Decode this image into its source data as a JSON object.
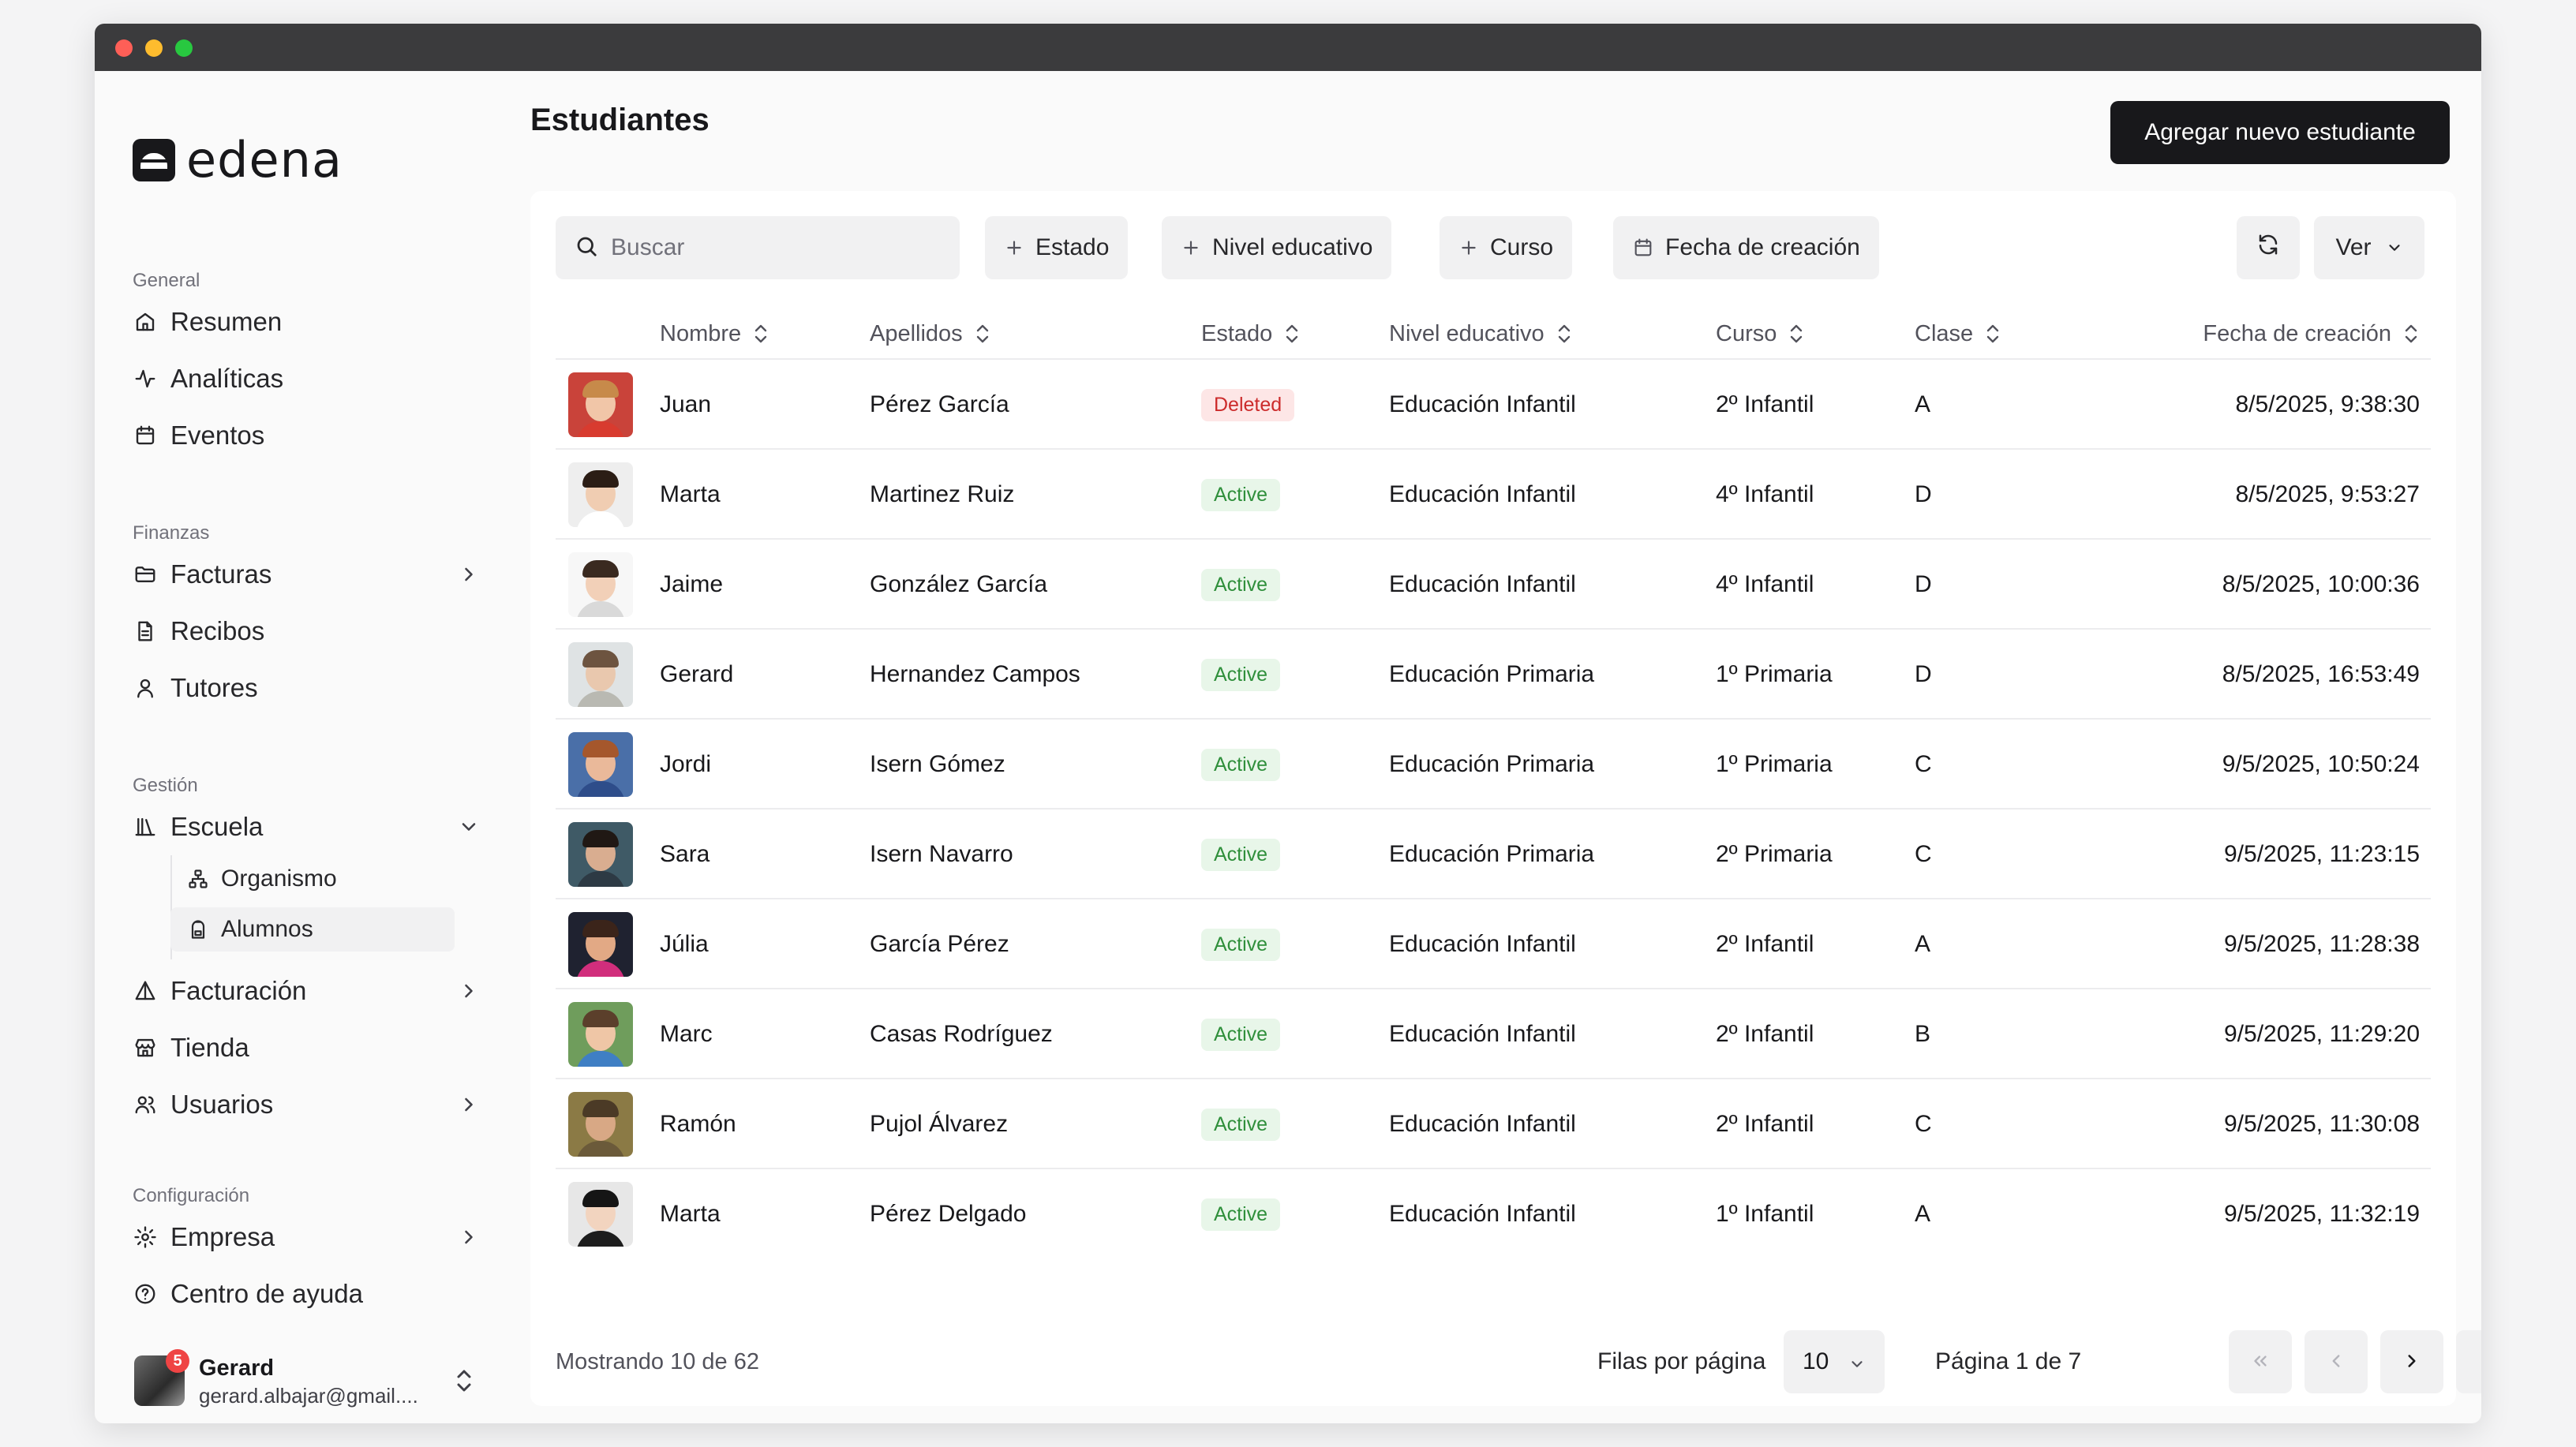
{
  "app": {
    "name": "edena"
  },
  "sidebar": {
    "sections": [
      {
        "label": "General",
        "items": [
          {
            "label": "Resumen",
            "icon": "home-icon"
          },
          {
            "label": "Analíticas",
            "icon": "activity-icon"
          },
          {
            "label": "Eventos",
            "icon": "calendar-icon"
          }
        ]
      },
      {
        "label": "Finanzas",
        "items": [
          {
            "label": "Facturas",
            "icon": "folder-icon",
            "has_children": true
          },
          {
            "label": "Recibos",
            "icon": "file-icon"
          },
          {
            "label": "Tutores",
            "icon": "user-icon"
          }
        ]
      },
      {
        "label": "Gestión",
        "items": [
          {
            "label": "Escuela",
            "icon": "library-icon",
            "expanded": true,
            "children": [
              {
                "label": "Organismo",
                "icon": "network-icon"
              },
              {
                "label": "Alumnos",
                "icon": "backpack-icon",
                "active": true
              }
            ]
          },
          {
            "label": "Facturación",
            "icon": "cone-icon",
            "has_children": true
          },
          {
            "label": "Tienda",
            "icon": "store-icon"
          },
          {
            "label": "Usuarios",
            "icon": "users-icon",
            "has_children": true
          }
        ]
      },
      {
        "label": "Configuración",
        "items": [
          {
            "label": "Empresa",
            "icon": "gear-icon",
            "has_children": true
          },
          {
            "label": "Centro de ayuda",
            "icon": "help-icon"
          }
        ]
      }
    ],
    "user": {
      "name": "Gerard",
      "email": "gerard.albajar@gmail....",
      "notifications": "5"
    }
  },
  "header": {
    "title": "Estudiantes",
    "add_button": "Agregar nuevo estudiante"
  },
  "toolbar": {
    "search_placeholder": "Buscar",
    "filters": [
      "Estado",
      "Nivel educativo",
      "Curso"
    ],
    "date_filter": "Fecha de creación",
    "view_label": "Ver"
  },
  "table": {
    "columns": [
      "Nombre",
      "Apellidos",
      "Estado",
      "Nivel educativo",
      "Curso",
      "Clase",
      "Fecha de creación"
    ],
    "rows": [
      {
        "nombre": "Juan",
        "apellidos": "Pérez García",
        "estado": "Deleted",
        "nivel": "Educación Infantil",
        "curso": "2º Infantil",
        "clase": "A",
        "fecha": "8/5/2025, 9:38:30",
        "avatar": {
          "bg": "#c9433a",
          "hair": "#c78a4a",
          "skin": "#f1c6a8",
          "shirt": "#d83b2f"
        }
      },
      {
        "nombre": "Marta",
        "apellidos": "Martinez Ruiz",
        "estado": "Active",
        "nivel": "Educación Infantil",
        "curso": "4º Infantil",
        "clase": "D",
        "fecha": "8/5/2025, 9:53:27",
        "avatar": {
          "bg": "#eeeeee",
          "hair": "#2b1d15",
          "skin": "#f0cdb2",
          "shirt": "#ffffff"
        }
      },
      {
        "nombre": "Jaime",
        "apellidos": "González García",
        "estado": "Active",
        "nivel": "Educación Infantil",
        "curso": "4º Infantil",
        "clase": "D",
        "fecha": "8/5/2025, 10:00:36",
        "avatar": {
          "bg": "#f7f7f7",
          "hair": "#3a2a20",
          "skin": "#f2d0b8",
          "shirt": "#d9d9d9"
        }
      },
      {
        "nombre": "Gerard",
        "apellidos": "Hernandez Campos",
        "estado": "Active",
        "nivel": "Educación Primaria",
        "curso": "1º Primaria",
        "clase": "D",
        "fecha": "8/5/2025, 16:53:49",
        "avatar": {
          "bg": "#dfe3e4",
          "hair": "#6d5440",
          "skin": "#e9c8ae",
          "shirt": "#b9b9b2"
        }
      },
      {
        "nombre": "Jordi",
        "apellidos": "Isern Gómez",
        "estado": "Active",
        "nivel": "Educación Primaria",
        "curso": "1º Primaria",
        "clase": "C",
        "fecha": "9/5/2025, 10:50:24",
        "avatar": {
          "bg": "#4a6fa8",
          "hair": "#a5572c",
          "skin": "#eab99a",
          "shirt": "#2e4d8a"
        }
      },
      {
        "nombre": "Sara",
        "apellidos": "Isern Navarro",
        "estado": "Active",
        "nivel": "Educación Primaria",
        "curso": "2º Primaria",
        "clase": "C",
        "fecha": "9/5/2025, 11:23:15",
        "avatar": {
          "bg": "#3f5a66",
          "hair": "#201814",
          "skin": "#d9ad90",
          "shirt": "#2d3a44"
        }
      },
      {
        "nombre": "Júlia",
        "apellidos": "García Pérez",
        "estado": "Active",
        "nivel": "Educación Infantil",
        "curso": "2º Infantil",
        "clase": "A",
        "fecha": "9/5/2025, 11:28:38",
        "avatar": {
          "bg": "#1f2230",
          "hair": "#3b241a",
          "skin": "#e2a985",
          "shirt": "#d12e7c"
        }
      },
      {
        "nombre": "Marc",
        "apellidos": "Casas Rodríguez",
        "estado": "Active",
        "nivel": "Educación Infantil",
        "curso": "2º Infantil",
        "clase": "B",
        "fecha": "9/5/2025, 11:29:20",
        "avatar": {
          "bg": "#6f9d5c",
          "hair": "#5b3f2b",
          "skin": "#efc6a6",
          "shirt": "#3f7fc4"
        }
      },
      {
        "nombre": "Ramón",
        "apellidos": "Pujol Álvarez",
        "estado": "Active",
        "nivel": "Educación Infantil",
        "curso": "2º Infantil",
        "clase": "C",
        "fecha": "9/5/2025, 11:30:08",
        "avatar": {
          "bg": "#8b7a45",
          "hair": "#4b3a26",
          "skin": "#d8a885",
          "shirt": "#6b5a3a"
        }
      },
      {
        "nombre": "Marta",
        "apellidos": "Pérez Delgado",
        "estado": "Active",
        "nivel": "Educación Infantil",
        "curso": "1º Infantil",
        "clase": "A",
        "fecha": "9/5/2025, 11:32:19",
        "avatar": {
          "bg": "#e7e7e7",
          "hair": "#151515",
          "skin": "#f2d4bf",
          "shirt": "#1d1d1d"
        }
      }
    ]
  },
  "pagination": {
    "showing": "Mostrando 10 de 62",
    "rows_per_page_label": "Filas por página",
    "rows_per_page": "10",
    "page_label": "Página 1 de 7"
  },
  "colors": {
    "primary": "#18181b",
    "active_bg": "#e8f6e9",
    "active_text": "#2f8f3b",
    "deleted_bg": "#fde6e6",
    "deleted_text": "#cc2b2b"
  }
}
